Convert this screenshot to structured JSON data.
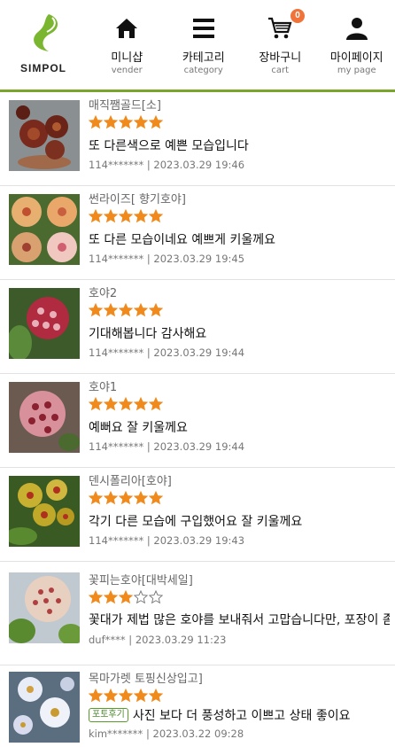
{
  "brand": {
    "name": "SIMPOL"
  },
  "nav": [
    {
      "label": "미니샵",
      "sub": "vender",
      "icon": "home-icon"
    },
    {
      "label": "카테고리",
      "sub": "category",
      "icon": "menu-icon"
    },
    {
      "label": "장바구니",
      "sub": "cart",
      "icon": "cart-icon",
      "badge": "0"
    },
    {
      "label": "마이페이지",
      "sub": "my page",
      "icon": "user-icon"
    }
  ],
  "colors": {
    "accent": "#7aa52a",
    "star": "#f08a1c",
    "badge": "#f0743a"
  },
  "reviews": [
    {
      "product": "매직쨈골드[소]",
      "rating": 5,
      "tag": "",
      "text": "또 다른색으로 예쁜 모습입니다",
      "user": "114*******",
      "date": "2023.03.29 19:46"
    },
    {
      "product": "썬라이즈[ 향기호야]",
      "rating": 5,
      "tag": "",
      "text": "또 다른 모습이네요 예쁘게 키울께요",
      "user": "114*******",
      "date": "2023.03.29 19:45"
    },
    {
      "product": "호야2",
      "rating": 5,
      "tag": "",
      "text": "기대해봅니다 감사해요",
      "user": "114*******",
      "date": "2023.03.29 19:44"
    },
    {
      "product": "호야1",
      "rating": 5,
      "tag": "",
      "text": "예뻐요 잘 키울께요",
      "user": "114*******",
      "date": "2023.03.29 19:44"
    },
    {
      "product": "덴시폴리아[호야]",
      "rating": 5,
      "tag": "",
      "text": "각기 다른 모습에 구입했어요 잘 키울께요",
      "user": "114*******",
      "date": "2023.03.29 19:43"
    },
    {
      "product": "꽃피는호야[대박세일]",
      "rating": 3,
      "tag": "",
      "text": "꽃대가 제법 많은 호야를 보내줘서 고맙습니다만, 포장이 좀 아쉬웠어요",
      "user": "duf****",
      "date": "2023.03.29 11:23"
    },
    {
      "product": "목마가렛 토핑신상입고]",
      "rating": 5,
      "tag": "포토후기",
      "text": "사진 보다 더 풍성하고 이쁘고 상태 좋이요",
      "user": "kim*******",
      "date": "2023.03.22 09:28"
    }
  ]
}
